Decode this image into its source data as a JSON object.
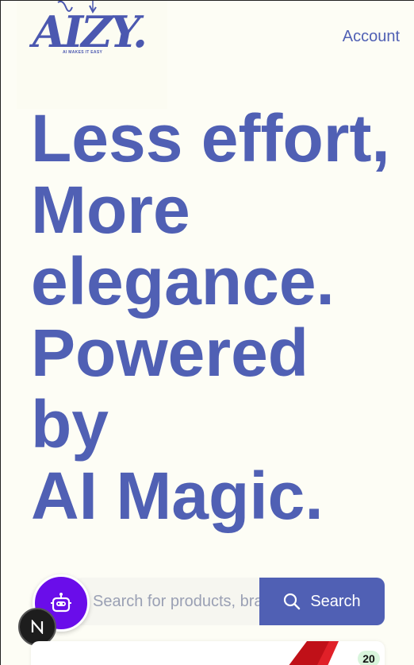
{
  "header": {
    "logo_text": "AIZY.",
    "logo_tagline": "AI MAKES IT EASY",
    "account_label": "Account"
  },
  "hero": {
    "line1": "Less effort,",
    "line2": "More",
    "line3": "elegance.",
    "line4": "Powered",
    "line5": "by",
    "line6": "AI Magic."
  },
  "search": {
    "placeholder": "Search for products, brand",
    "button_label": "Search"
  },
  "product_peek": {
    "badge_count": "20"
  },
  "colors": {
    "brand": "#5060b4",
    "background": "#fdfdf5",
    "chat_bubble": "#6a0dea"
  }
}
